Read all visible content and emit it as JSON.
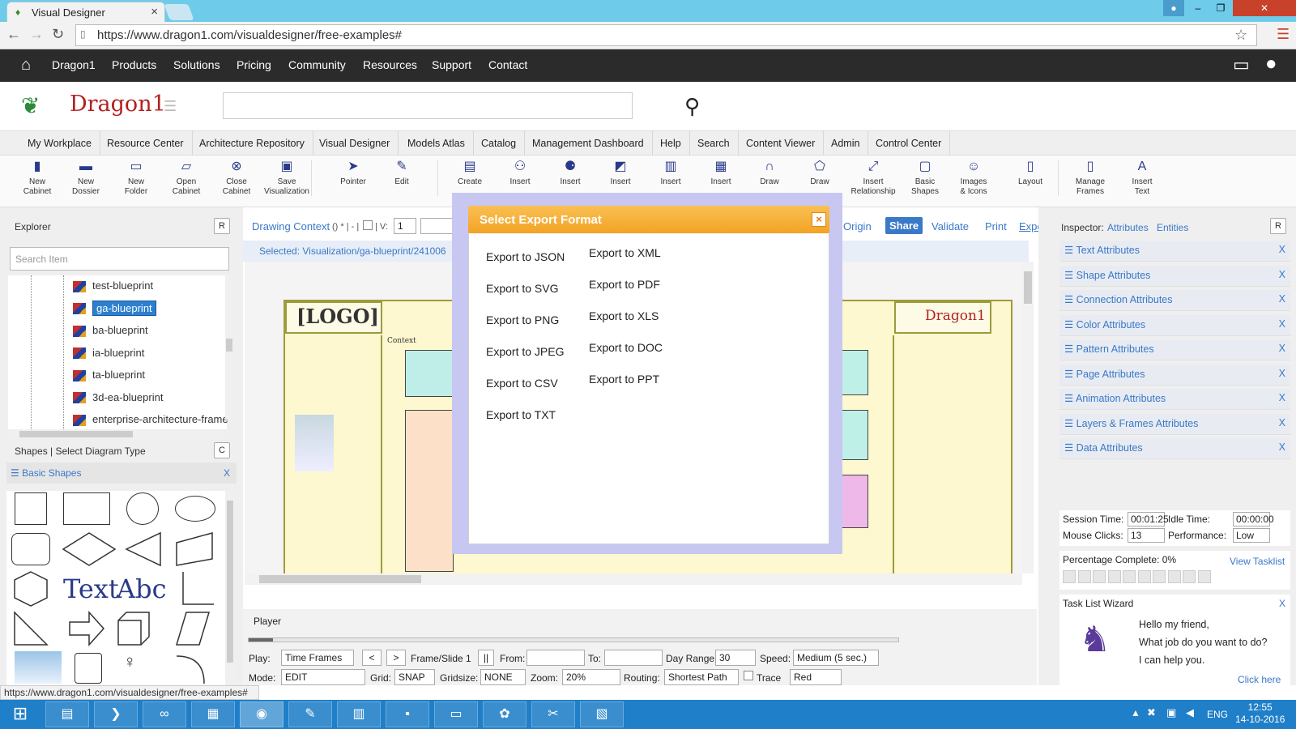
{
  "browser": {
    "tab_title": "Visual Designer",
    "url": "https://www.dragon1.com/visualdesigner/free-examples#"
  },
  "topnav": [
    "Dragon1",
    "Products",
    "Solutions",
    "Pricing",
    "Community",
    "Resources",
    "Support",
    "Contact"
  ],
  "logo": "Dragon1",
  "menubar": [
    "My Workplace",
    "Resource Center",
    "Architecture Repository",
    "Visual Designer",
    "Models Atlas",
    "Catalog",
    "Management Dashboard",
    "Help",
    "Search",
    "Content Viewer",
    "Admin",
    "Control Center"
  ],
  "toolbar": [
    {
      "l1": "New",
      "l2": "Cabinet",
      "icon": "cabinet-icon",
      "glyph": "▮"
    },
    {
      "l1": "New",
      "l2": "Dossier",
      "icon": "dossier-icon",
      "glyph": "▬"
    },
    {
      "l1": "New",
      "l2": "Folder",
      "icon": "folder-icon",
      "glyph": "▭"
    },
    {
      "l1": "Open",
      "l2": "Cabinet",
      "icon": "open-folder-icon",
      "glyph": "▱"
    },
    {
      "l1": "Close",
      "l2": "Cabinet",
      "icon": "close-circle-icon",
      "glyph": "⊗"
    },
    {
      "l1": "Save",
      "l2": "Visualization",
      "icon": "floppy-icon",
      "glyph": "▣"
    },
    {
      "l1": "Pointer",
      "l2": "",
      "icon": "pointer-icon",
      "glyph": "➤"
    },
    {
      "l1": "Edit",
      "l2": "",
      "icon": "edit-icon",
      "glyph": "✎"
    },
    {
      "l1": "Create",
      "l2": "",
      "icon": "create-icon",
      "glyph": "▤"
    },
    {
      "l1": "Insert",
      "l2": "",
      "icon": "insert-tree-icon",
      "glyph": "⚇"
    },
    {
      "l1": "Insert",
      "l2": "",
      "icon": "insert-network-icon",
      "glyph": "⚈"
    },
    {
      "l1": "Insert",
      "l2": "",
      "icon": "insert-image-icon",
      "glyph": "◩"
    },
    {
      "l1": "Insert",
      "l2": "",
      "icon": "insert-chart-icon",
      "glyph": "▥"
    },
    {
      "l1": "Insert",
      "l2": "",
      "icon": "insert-table-icon",
      "glyph": "▦"
    },
    {
      "l1": "Draw",
      "l2": "",
      "icon": "draw-arch-icon",
      "glyph": "∩"
    },
    {
      "l1": "Draw",
      "l2": "",
      "icon": "draw-shape-icon",
      "glyph": "⬠"
    },
    {
      "l1": "Insert",
      "l2": "Relationship",
      "icon": "relationship-icon",
      "glyph": "⤢"
    },
    {
      "l1": "Basic",
      "l2": "Shapes",
      "icon": "basic-shapes-icon",
      "glyph": "▢"
    },
    {
      "l1": "Images",
      "l2": "& Icons",
      "icon": "smiley-icon",
      "glyph": "☺"
    },
    {
      "l1": "Layout",
      "l2": "",
      "icon": "layout-icon",
      "glyph": "▯"
    },
    {
      "l1": "Manage",
      "l2": "Frames",
      "icon": "frames-icon",
      "glyph": "▯"
    },
    {
      "l1": "Insert",
      "l2": "Text",
      "icon": "text-icon",
      "glyph": "A"
    }
  ],
  "explorer": {
    "title": "Explorer",
    "r_label": "R",
    "search_placeholder": "Search Item",
    "items": [
      "test-blueprint",
      "ga-blueprint",
      "ba-blueprint",
      "ia-blueprint",
      "ta-blueprint",
      "3d-ea-blueprint",
      "enterprise-architecture-frame"
    ],
    "selected_index": 1
  },
  "shapes_panel": {
    "title": "Shapes | Select Diagram Type",
    "c_label": "C",
    "group": "☰ Basic Shapes",
    "group_close": "X",
    "text_shape": "Text",
    "abc_shape": "Abc"
  },
  "center": {
    "drawing_context": "Drawing Context",
    "dc_suffix": "() * | - |",
    "v_label": "| V:",
    "v_value": "1",
    "links": [
      "Origin",
      "Share",
      "Validate",
      "Print",
      "Export"
    ],
    "selected_path": "Selected: Visualization/ga-blueprint/241006",
    "diagram_logo": "[LOGO]",
    "diagram_brand": "Dragon1",
    "diagram_context": "Context"
  },
  "player": {
    "title": "Player",
    "play_label": "Play:",
    "time_frames": "Time Frames",
    "prev": "<",
    "next": ">",
    "frame_slide": "Frame/Slide 1",
    "pause": "||",
    "from_label": "From:",
    "to_label": "To:",
    "day_range_label": "Day Range:",
    "day_range_value": "30",
    "speed_label": "Speed:",
    "speed_value": "Medium (5 sec.)",
    "mode_label": "Mode:",
    "mode_value": "EDIT",
    "grid_label": "Grid:",
    "grid_value": "SNAP",
    "gridsize_label": "Gridsize:",
    "gridsize_value": "NONE",
    "zoom_label": "Zoom:",
    "zoom_value": "20%",
    "routing_label": "Routing:",
    "routing_value": "Shortest Path",
    "trace_label": "Trace",
    "color_value": "Red"
  },
  "inspector": {
    "title": "Inspector:",
    "link1": "Attributes",
    "link2": "Entities",
    "r_label": "R",
    "attributes": [
      "☰ Text Attributes",
      "☰ Shape Attributes",
      "☰ Connection Attributes",
      "☰ Color Attributes",
      "☰ Pattern Attributes",
      "☰ Page Attributes",
      "☰ Animation Attributes",
      "☰ Layers & Frames Attributes",
      "☰ Data Attributes"
    ],
    "close": "X",
    "session_time_label": "Session Time:",
    "session_time": "00:01:25",
    "idle_time_label": "Idle Time:",
    "idle_time": "00:00:00",
    "mouse_clicks_label": "Mouse Clicks:",
    "mouse_clicks": "13",
    "performance_label": "Performance:",
    "performance": "Low",
    "percentage": "Percentage Complete: 0%",
    "view_tasklist": "View Tasklist",
    "wizard_title": "Task List Wizard",
    "wizard_lines": [
      "Hello my friend,",
      "What job do you want to do?",
      "I can help you."
    ],
    "click_here": "Click here"
  },
  "modal": {
    "title": "Select Export Format",
    "close": "×",
    "col1": [
      "Export to JSON",
      "Export to SVG",
      "Export to PNG",
      "Export to JPEG",
      "Export to CSV",
      "Export to TXT"
    ],
    "col2": [
      "Export to XML",
      "Export to PDF",
      "Export to XLS",
      "Export to DOC",
      "Export to PPT"
    ]
  },
  "status_url": "https://www.dragon1.com/visualdesigner/free-examples#",
  "taskbar": {
    "lang": "ENG",
    "time": "12:55",
    "date": "14-10-2016"
  },
  "colors": {
    "accent": "#3a78c8",
    "modal_header": "#f3a325",
    "topnav": "#2b2b2b",
    "taskbar": "#1f7fc8"
  }
}
